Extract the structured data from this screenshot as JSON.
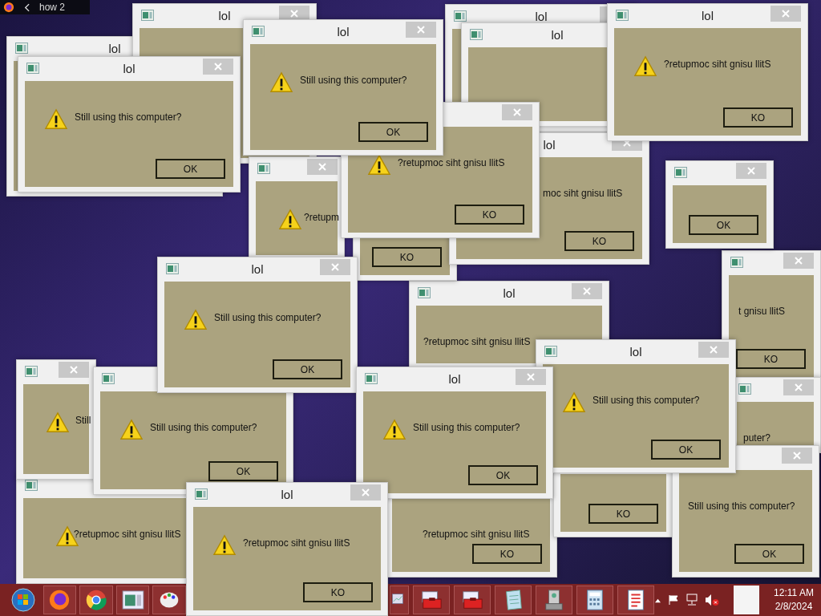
{
  "browser_strip": {
    "tab_title": "how 2"
  },
  "windows": [
    {
      "title": "lol"
    },
    {
      "title": "lol"
    },
    {
      "title": "lol"
    },
    {
      "title": "lol"
    },
    {
      "message": "?retupmoc siht gnisu llitS"
    },
    {
      "message": "?retupmoc siht gnisu llitS",
      "button": "KO"
    },
    {
      "button": "KO"
    },
    {
      "message": "t gnisu llitS",
      "button": "KO"
    },
    {
      "message": "puter?"
    },
    {
      "button": "OK"
    },
    {
      "title": "lol",
      "message": "?retupmoc siht gnisu llitS"
    },
    {
      "message": "Still"
    },
    {
      "message": "Still using this computer?",
      "button": "OK"
    },
    {
      "message": "?retupm"
    },
    {
      "button": "KO"
    },
    {
      "title": "lol",
      "message": "moc siht gnisu llitS",
      "button": "KO"
    },
    {
      "title": "lol",
      "message": "Still using this computer?",
      "button": "OK"
    },
    {
      "message": "?retupmoc siht gnisu llitS",
      "button": "KO"
    },
    {
      "title": "lol",
      "message": "Still using this computer?",
      "button": "OK"
    },
    {
      "title": "lol",
      "message": "?retupmoc siht gnisu llitS",
      "button": "KO"
    },
    {
      "title": "lol",
      "message": "Still using this computer?",
      "button": "OK"
    },
    {
      "message": "Still using this computer?",
      "button": "OK"
    },
    {
      "title": "lol",
      "message": "Still using this computer?",
      "button": "OK"
    },
    {
      "title": "lol",
      "message": "Still using this computer?",
      "button": "OK"
    },
    {
      "title": "lol",
      "message": "?retupmoc siht gnisu llitS",
      "button": "KO"
    }
  ],
  "taskbar": {
    "volume_muted": true,
    "clock_time": "12:11 AM",
    "clock_date": "2/8/2024"
  }
}
